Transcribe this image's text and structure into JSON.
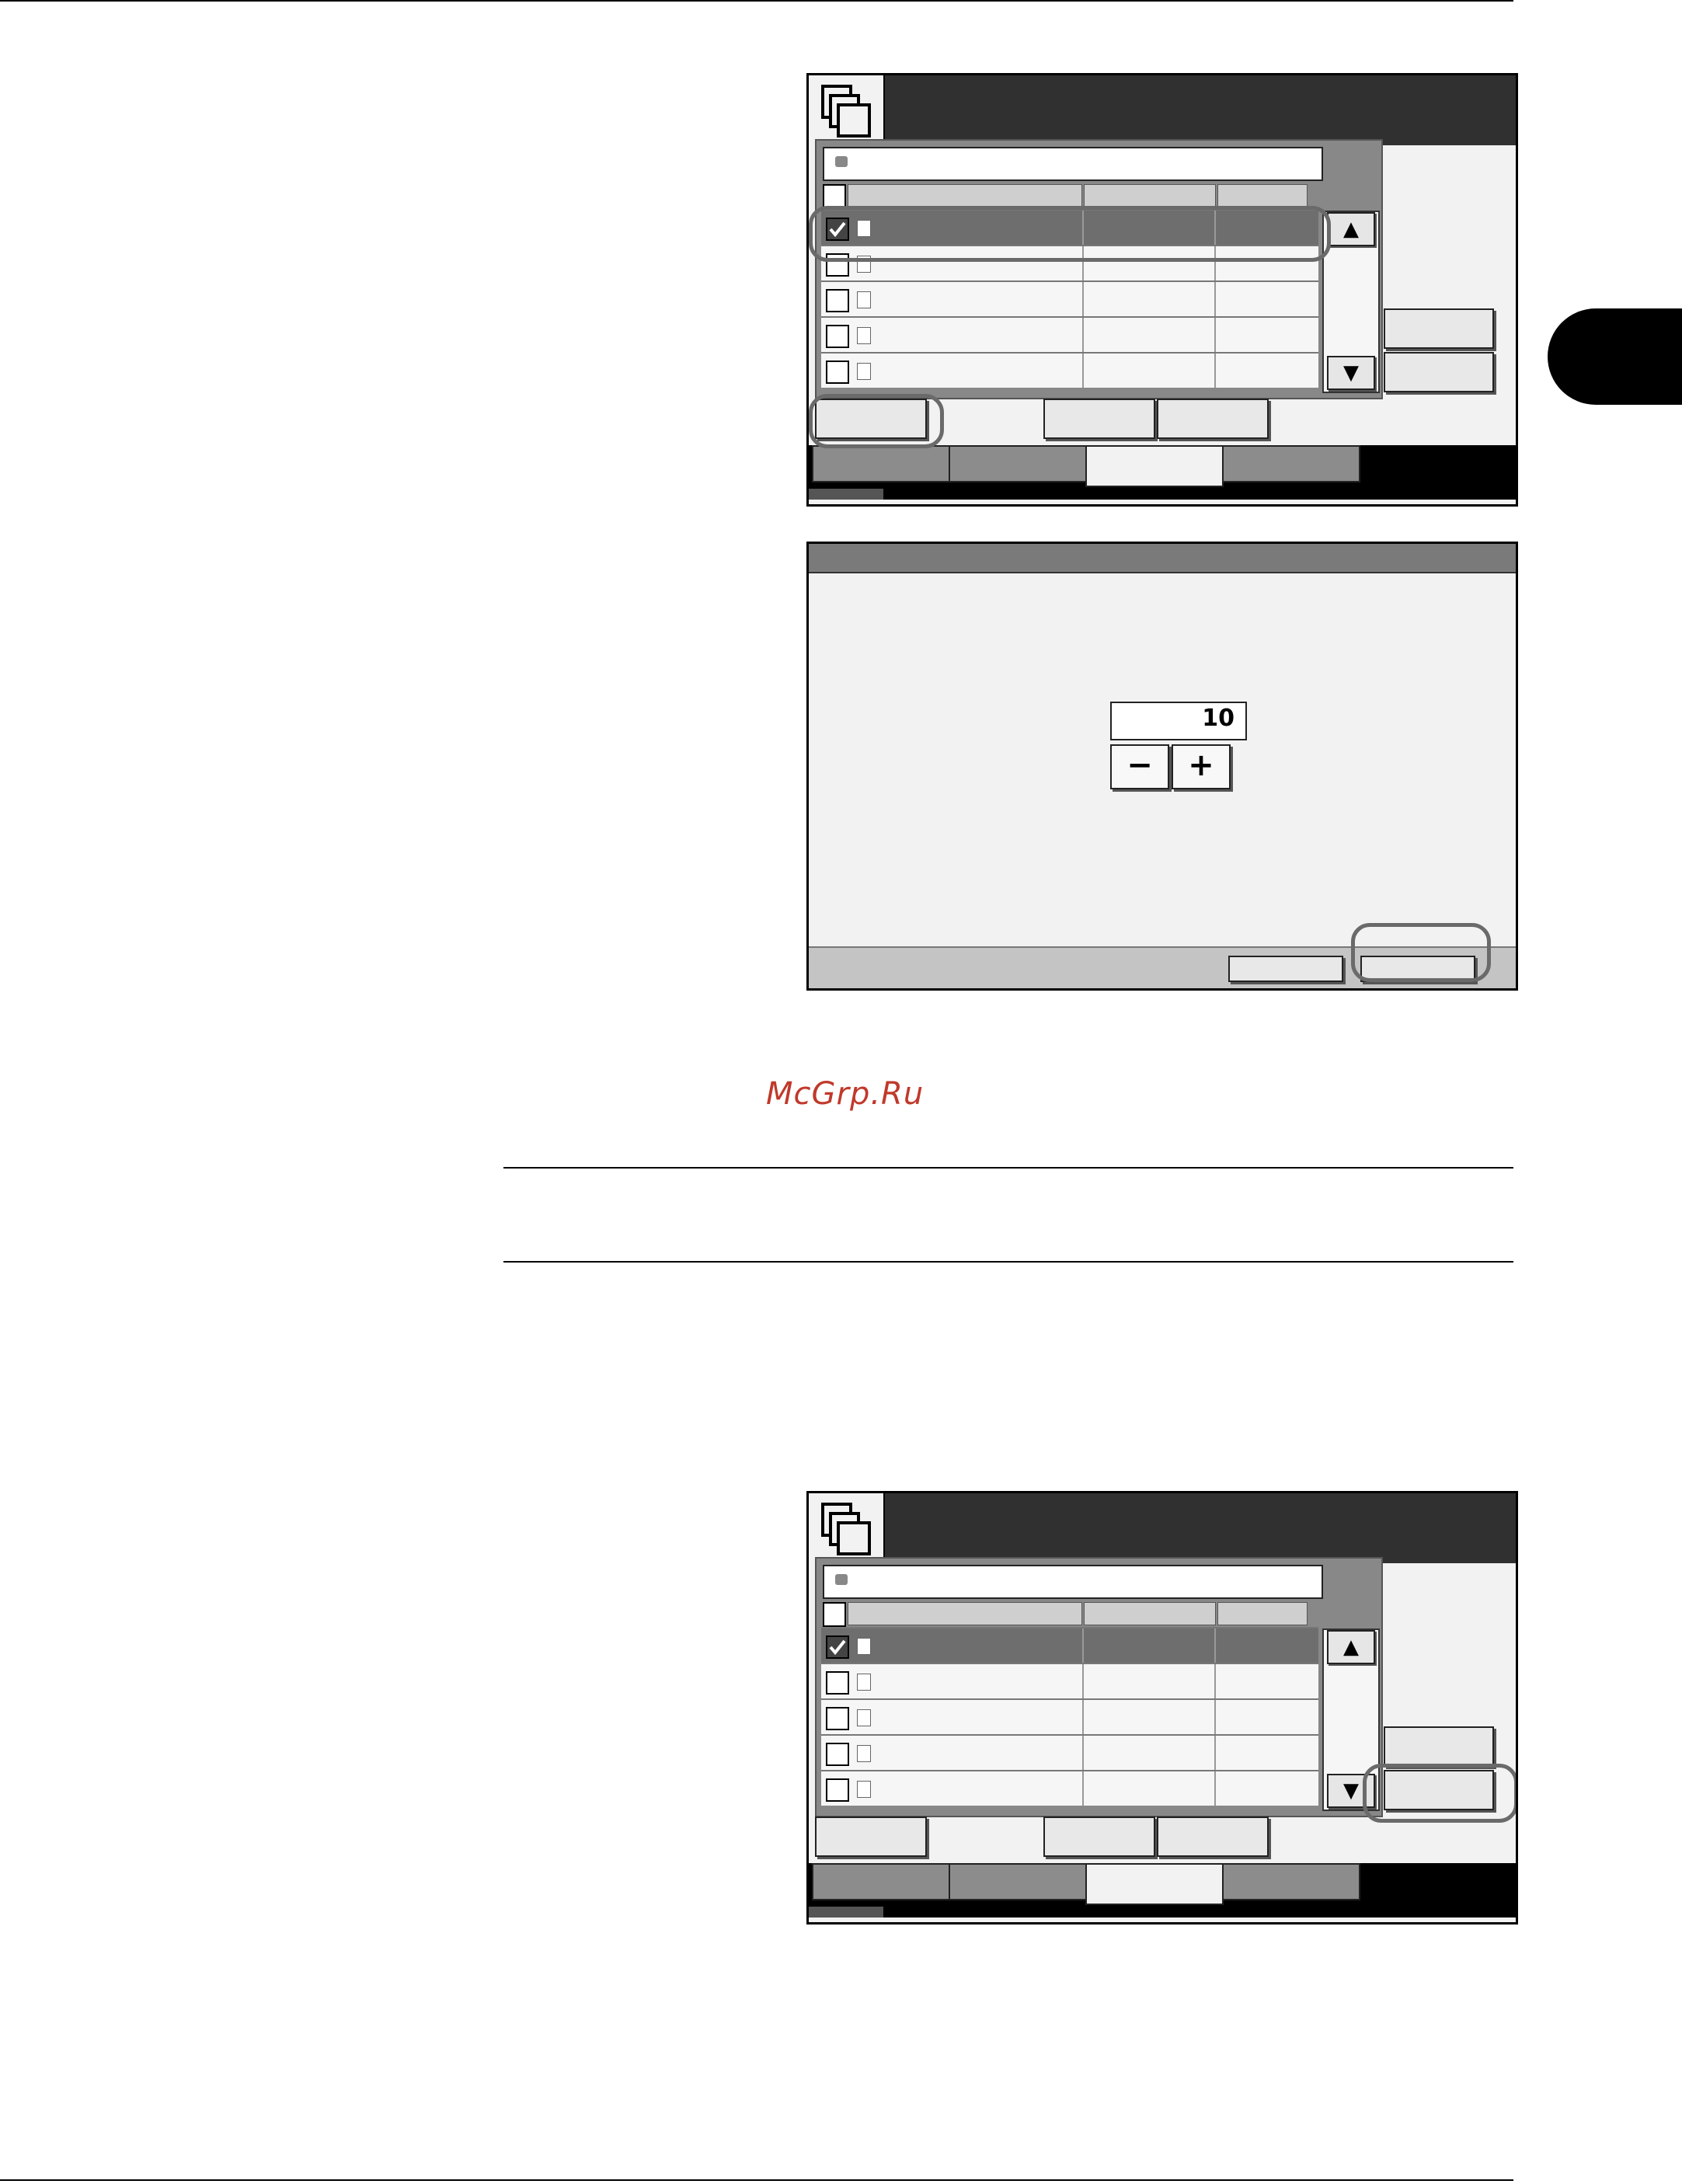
{
  "watermark": "McGrp.Ru",
  "dialog": {
    "counter_value": "10",
    "minus_label": "−",
    "plus_label": "+"
  },
  "scroll": {
    "up_label": "▲",
    "down_label": "▼"
  },
  "colors": {
    "panel_bg": "#f2f2f2",
    "titlebar": "#303030",
    "selected_row": "#6e6e6e",
    "highlight_ring": "#6a6a6a",
    "watermark": "#c0392b"
  }
}
